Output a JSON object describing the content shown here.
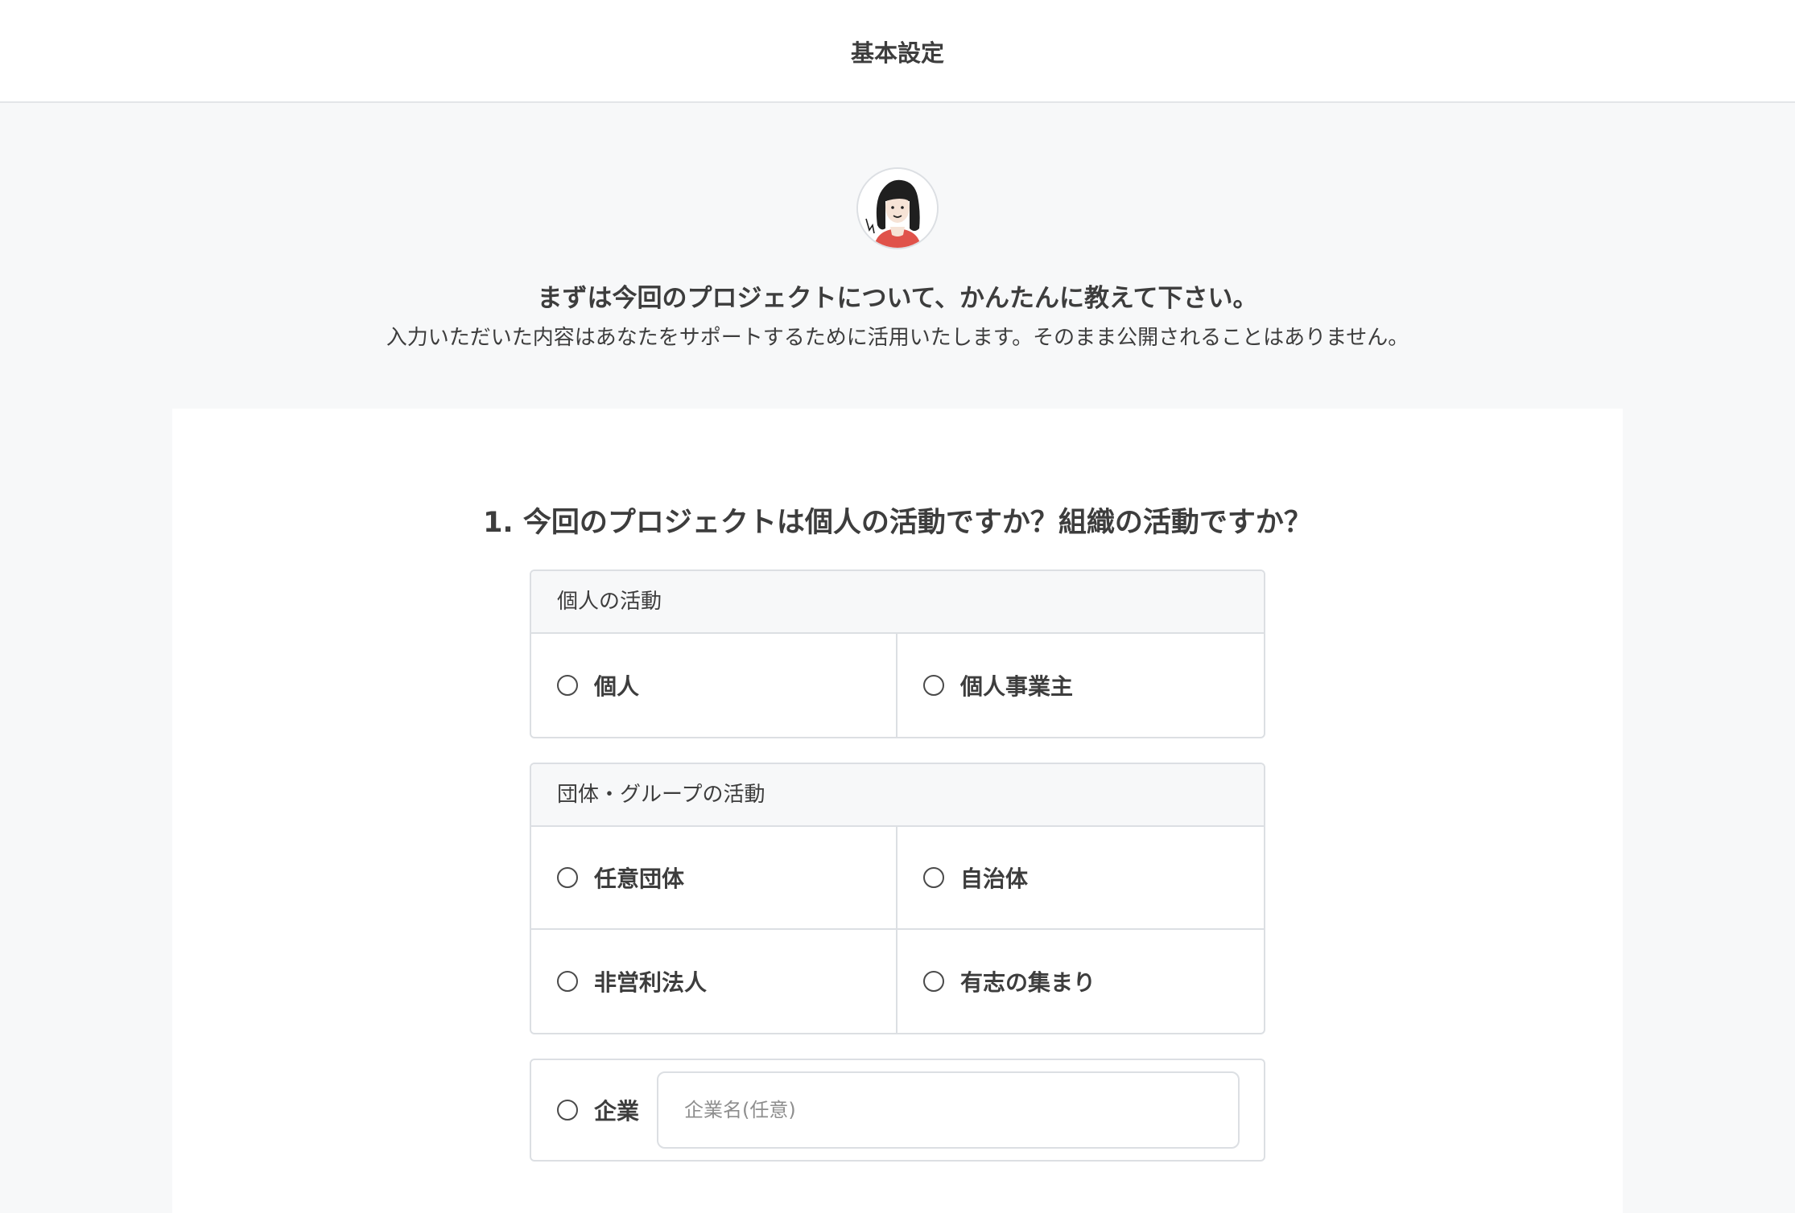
{
  "header": {
    "title": "基本設定"
  },
  "intro": {
    "lead": "まずは今回のプロジェクトについて、かんたんに教えて下さい。",
    "sub": "入力いただいた内容はあなたをサポートするために活用いたします。そのまま公開されることはありません。"
  },
  "question": {
    "title": "1. 今回のプロジェクトは個人の活動ですか？組織の活動ですか？",
    "groups": [
      {
        "heading": "個人の活動",
        "options": [
          "個人",
          "個人事業主"
        ]
      },
      {
        "heading": "団体・グループの活動",
        "options": [
          "任意団体",
          "自治体",
          "非営利法人",
          "有志の集まり"
        ]
      }
    ],
    "company": {
      "label": "企業",
      "placeholder": "企業名(任意)",
      "value": ""
    }
  }
}
